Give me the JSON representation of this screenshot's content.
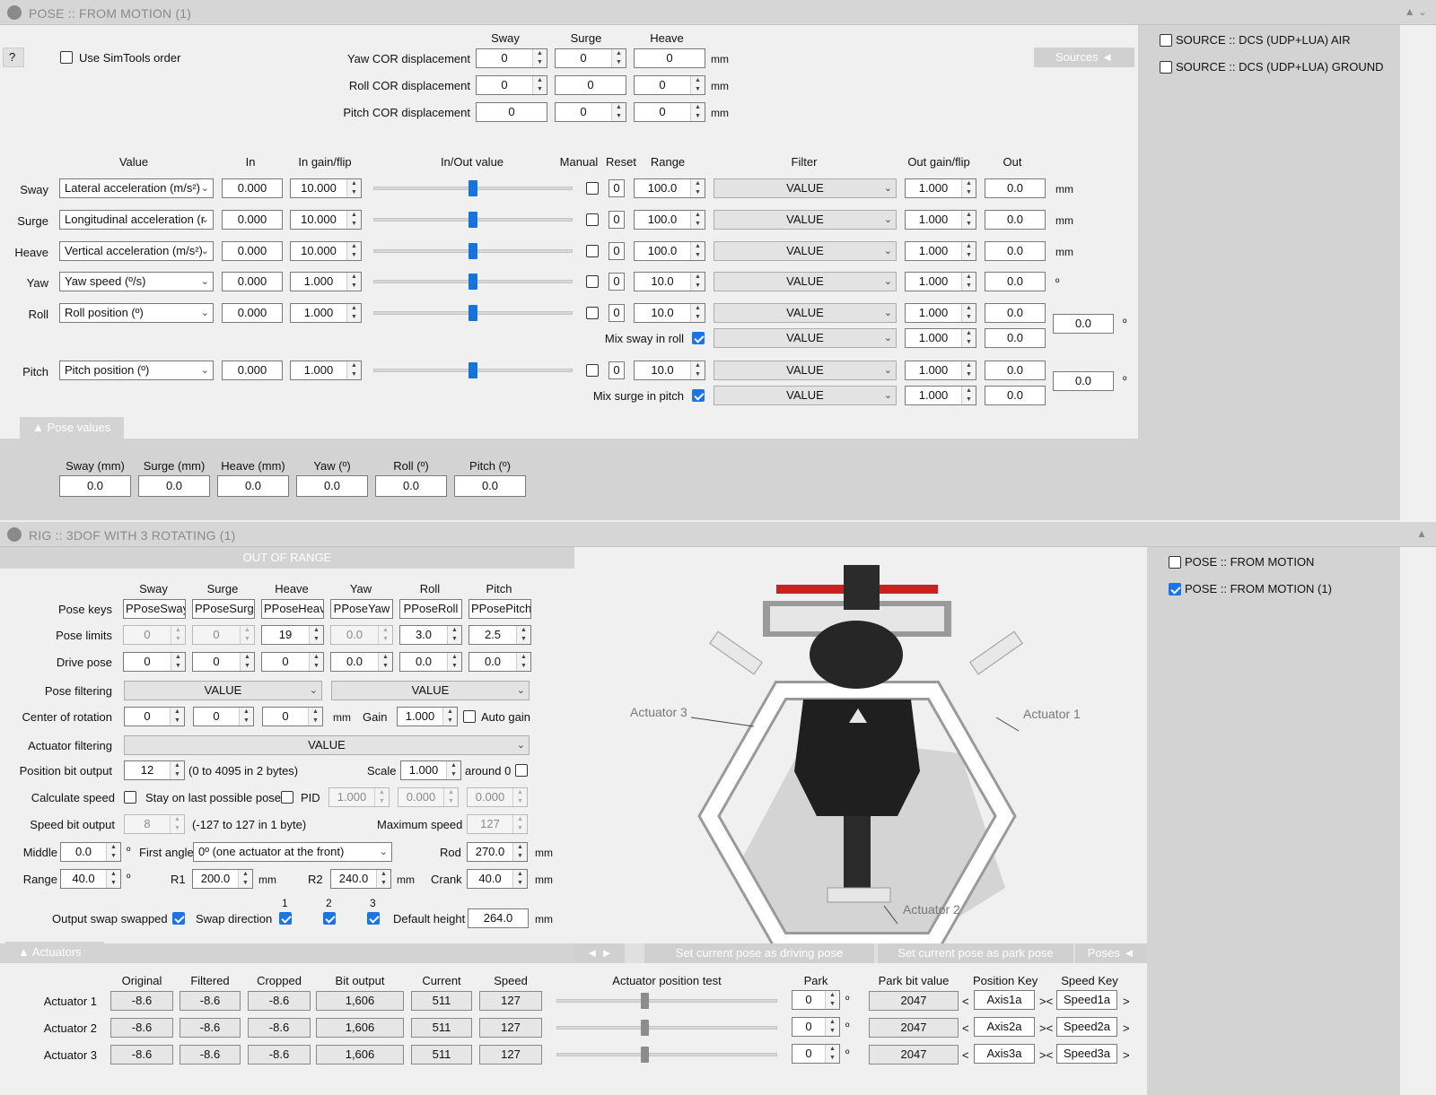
{
  "pose_window": {
    "title": "POSE :: FROM MOTION (1)",
    "help": "?",
    "use_simtools_order": "Use SimTools order",
    "sources_button": "Sources",
    "sources_list": [
      "SOURCE :: DCS (UDP+LUA) AIR",
      "SOURCE :: DCS (UDP+LUA) GROUND"
    ],
    "cor": {
      "headers": [
        "Sway",
        "Surge",
        "Heave"
      ],
      "unit": "mm",
      "rows": [
        {
          "label": "Yaw COR displacement",
          "values": [
            "0",
            "0",
            "0"
          ]
        },
        {
          "label": "Roll COR displacement",
          "values": [
            "0",
            "0",
            "0"
          ]
        },
        {
          "label": "Pitch COR displacement",
          "values": [
            "0",
            "0",
            "0"
          ]
        }
      ]
    },
    "columns": {
      "value": "Value",
      "in": "In",
      "in_gain": "In gain/flip",
      "inout": "In/Out value",
      "manual": "Manual",
      "reset": "Reset",
      "range": "Range",
      "filter": "Filter",
      "out_gain": "Out gain/flip",
      "out": "Out"
    },
    "axes": [
      {
        "name": "Sway",
        "source": "Lateral acceleration (m/s²)",
        "in": "0.000",
        "gain": "10.000",
        "reset": "0",
        "range": "100.0",
        "filter": "VALUE",
        "out_gain": "1.000",
        "out": "0.0",
        "unit": "mm",
        "level": 0.5
      },
      {
        "name": "Surge",
        "source": "Longitudinal acceleration (r",
        "in": "0.000",
        "gain": "10.000",
        "reset": "0",
        "range": "100.0",
        "filter": "VALUE",
        "out_gain": "1.000",
        "out": "0.0",
        "unit": "mm",
        "level": 0.5
      },
      {
        "name": "Heave",
        "source": "Vertical acceleration (m/s²)",
        "in": "0.000",
        "gain": "10.000",
        "reset": "0",
        "range": "100.0",
        "filter": "VALUE",
        "out_gain": "1.000",
        "out": "0.0",
        "unit": "mm",
        "level": 0.5
      },
      {
        "name": "Yaw",
        "source": "Yaw speed (º/s)",
        "in": "0.000",
        "gain": "1.000",
        "reset": "0",
        "range": "10.0",
        "filter": "VALUE",
        "out_gain": "1.000",
        "out": "0.0",
        "unit": "º",
        "level": 0.5
      },
      {
        "name": "Roll",
        "source": "Roll position (º)",
        "in": "0.000",
        "gain": "1.000",
        "reset": "0",
        "range": "10.0",
        "filter": "VALUE",
        "out_gain": "1.000",
        "out": "0.0",
        "unit": "",
        "level": 0.5
      },
      {
        "name": "Pitch",
        "source": "Pitch position (º)",
        "in": "0.000",
        "gain": "1.000",
        "reset": "0",
        "range": "10.0",
        "filter": "VALUE",
        "out_gain": "1.000",
        "out": "0.0",
        "unit": "",
        "level": 0.5
      }
    ],
    "mix_sway": {
      "label": "Mix sway in roll",
      "filter": "VALUE",
      "gain": "1.000",
      "out": "0.0"
    },
    "mix_surge": {
      "label": "Mix surge in pitch",
      "filter": "VALUE",
      "gain": "1.000",
      "out": "0.0"
    },
    "roll_total": "0.0",
    "pitch_total": "0.0",
    "deg": "º",
    "pose_values_tab": "Pose values",
    "pose_values": [
      {
        "label": "Sway (mm)",
        "value": "0.0"
      },
      {
        "label": "Surge (mm)",
        "value": "0.0"
      },
      {
        "label": "Heave (mm)",
        "value": "0.0"
      },
      {
        "label": "Yaw (º)",
        "value": "0.0"
      },
      {
        "label": "Roll (º)",
        "value": "0.0"
      },
      {
        "label": "Pitch (º)",
        "value": "0.0"
      }
    ]
  },
  "rig_window": {
    "title": "RIG :: 3DOF WITH 3 ROTATING (1)",
    "out_of_range": "OUT OF RANGE",
    "col_headers": [
      "Sway",
      "Surge",
      "Heave",
      "Yaw",
      "Roll",
      "Pitch"
    ],
    "pose_keys_label": "Pose keys",
    "pose_keys": [
      "PPoseSway",
      "PPoseSurge",
      "PPoseHeave",
      "PPoseYaw",
      "PPoseRoll",
      "PPosePitch"
    ],
    "pose_limits_label": "Pose limits",
    "pose_limits": [
      "0",
      "0",
      "19",
      "0.0",
      "3.0",
      "2.5"
    ],
    "drive_pose_label": "Drive pose",
    "drive_pose": [
      "0",
      "0",
      "0",
      "0.0",
      "0.0",
      "0.0"
    ],
    "pose_filtering_label": "Pose filtering",
    "pose_filtering": [
      "VALUE",
      "VALUE"
    ],
    "center_label": "Center of rotation",
    "center": [
      "0",
      "0",
      "0"
    ],
    "mm": "mm",
    "gain_label": "Gain",
    "gain": "1.000",
    "auto_gain": "Auto gain",
    "actuator_filtering_label": "Actuator filtering",
    "actuator_filtering": "VALUE",
    "pos_bit_label": "Position bit output",
    "pos_bit": "12",
    "pos_bit_note": "(0 to 4095 in 2 bytes)",
    "scale_label": "Scale",
    "scale": "1.000",
    "around0": "around 0",
    "calc_speed": "Calculate speed",
    "stay_last": "Stay on last possible pose",
    "pid": "PID",
    "pid_values": [
      "1.000",
      "0.000",
      "0.000"
    ],
    "speed_bit_label": "Speed bit output",
    "speed_bit": "8",
    "speed_bit_note": "(-127 to 127 in 1 byte)",
    "max_speed_label": "Maximum speed",
    "max_speed": "127",
    "middle_label": "Middle",
    "middle": "0.0",
    "first_angle_label": "First angle",
    "first_angle": "0º (one actuator at the front)",
    "rod_label": "Rod",
    "rod": "270.0",
    "range_label": "Range",
    "range": "40.0",
    "r1_label": "R1",
    "r1": "200.0",
    "r2_label": "R2",
    "r2": "240.0",
    "crank_label": "Crank",
    "crank": "40.0",
    "deg": "º",
    "output_swap": "Output swap swapped",
    "swap_direction": "Swap direction",
    "swap_nums": [
      "1",
      "2",
      "3"
    ],
    "default_height_label": "Default height",
    "default_height": "264.0",
    "viewport_labels": [
      "Actuator 3",
      "Actuator 1",
      "Actuator 2"
    ],
    "nav_arrows": "◄ ►",
    "set_driving": "Set current pose as driving pose",
    "set_park": "Set current pose as park pose",
    "poses_button": "Poses",
    "poses_list": [
      "POSE :: FROM MOTION",
      "POSE :: FROM MOTION (1)"
    ],
    "actuators_tab": "Actuators",
    "act_headers": {
      "original": "Original",
      "filtered": "Filtered",
      "cropped": "Cropped",
      "bit": "Bit output",
      "current": "Current",
      "speed": "Speed",
      "test": "Actuator position test",
      "park": "Park",
      "park_bit": "Park bit value",
      "pos_key": "Position Key",
      "speed_key": "Speed Key"
    },
    "actuators": [
      {
        "name": "Actuator 1",
        "original": "-8.6",
        "filtered": "-8.6",
        "cropped": "-8.6",
        "bit": "1,606",
        "current": "511",
        "speed": "127",
        "park": "0",
        "park_bit": "2047",
        "pos_key": "Axis1a",
        "speed_key": "Speed1a",
        "level": 0.4
      },
      {
        "name": "Actuator 2",
        "original": "-8.6",
        "filtered": "-8.6",
        "cropped": "-8.6",
        "bit": "1,606",
        "current": "511",
        "speed": "127",
        "park": "0",
        "park_bit": "2047",
        "pos_key": "Axis2a",
        "speed_key": "Speed2a",
        "level": 0.4
      },
      {
        "name": "Actuator 3",
        "original": "-8.6",
        "filtered": "-8.6",
        "cropped": "-8.6",
        "bit": "1,606",
        "current": "511",
        "speed": "127",
        "park": "0",
        "park_bit": "2047",
        "pos_key": "Axis3a",
        "speed_key": "Speed3a",
        "level": 0.4
      }
    ],
    "lt": "<",
    "gtlt": "><",
    "gt": ">"
  },
  "colors": {
    "accent": "#1a73e8",
    "pane": "#d3d3d3",
    "title": "#d6d6d6"
  }
}
